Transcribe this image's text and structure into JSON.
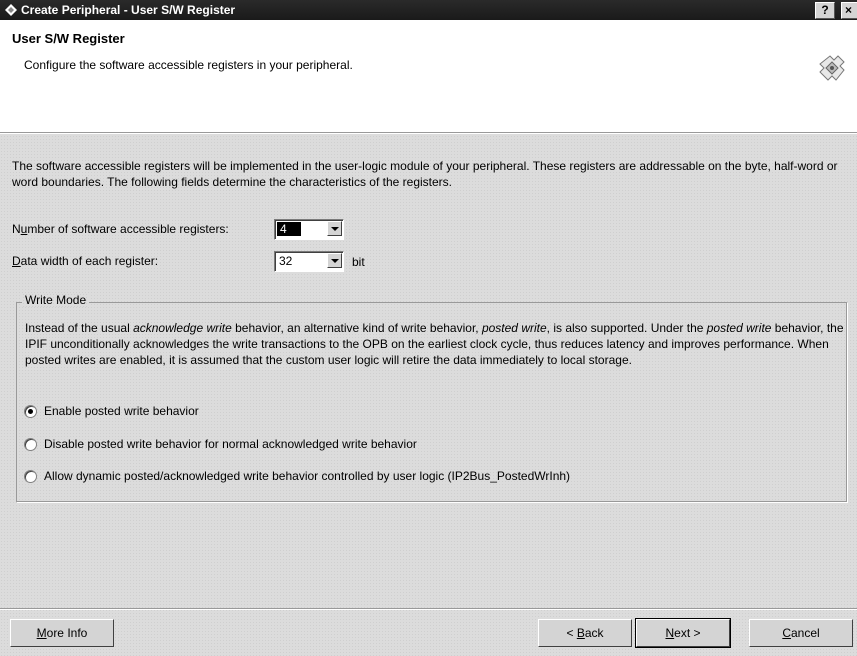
{
  "window": {
    "title": "Create Peripheral - User S/W Register",
    "help_label": "?",
    "close_label": "×"
  },
  "header": {
    "title": "User S/W Register",
    "subtitle": "Configure the software accessible registers in your peripheral."
  },
  "intro_text": "The software accessible registers will be implemented in the user-logic module of your peripheral. These registers are addressable on the byte, half-word or word boundaries. The following fields determine the characteristics of the registers.",
  "fields": {
    "num_registers": {
      "label_pre": "N",
      "label_u": "u",
      "label_post": "mber of software accessible registers:",
      "value": "4"
    },
    "data_width": {
      "label_u": "D",
      "label_post": "ata width of each register:",
      "value": "32",
      "unit": "bit"
    }
  },
  "write_mode": {
    "legend": "Write Mode",
    "desc": {
      "p1": "Instead of the usual ",
      "em1": "acknowledge write",
      "p2": " behavior, an alternative kind of write behavior, ",
      "em2": "posted write",
      "p3": ", is also supported. Under the ",
      "em3": "posted write",
      "p4": " behavior, the IPIF unconditionally acknowledges the write transactions to the OPB on the earliest clock cycle, thus reduces latency and improves performance. When posted writes are enabled, it is assumed that the custom user logic will retire the data immediately to local storage."
    },
    "options": [
      {
        "label": "Enable posted write behavior",
        "selected": true
      },
      {
        "label": "Disable posted write behavior for normal acknowledged write behavior",
        "selected": false
      },
      {
        "label": "Allow dynamic posted/acknowledged write behavior controlled by user logic (IP2Bus_PostedWrInh)",
        "selected": false
      }
    ]
  },
  "buttons": {
    "more_info": {
      "u": "M",
      "rest": "ore Info"
    },
    "back": {
      "pre": "< ",
      "u": "B",
      "rest": "ack"
    },
    "next": {
      "u": "N",
      "rest": "ext >"
    },
    "cancel": {
      "u": "C",
      "rest": "ancel"
    }
  }
}
